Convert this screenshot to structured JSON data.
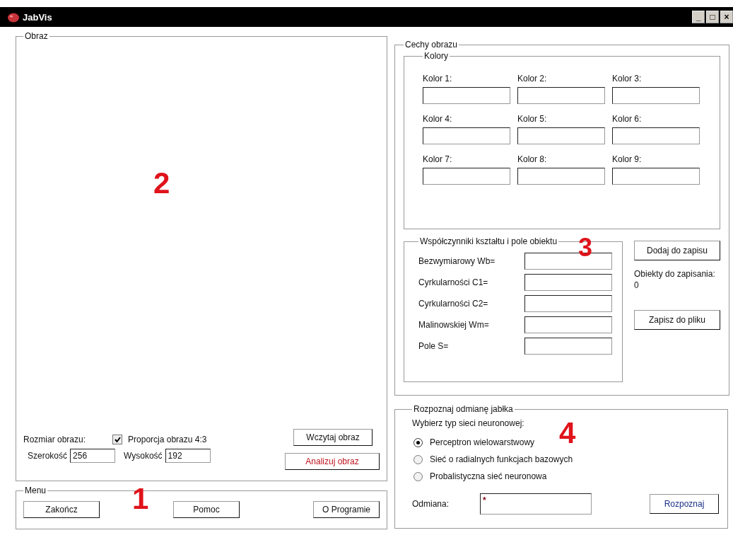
{
  "window": {
    "title": "JabVis",
    "controls": [
      "_",
      "□",
      "×"
    ]
  },
  "image_panel": {
    "title": "Obraz",
    "annotation": "2",
    "size_label": "Rozmiar obrazu:",
    "aspect": {
      "label": "Proporcja obrazu 4:3",
      "checked": true
    },
    "width_label": "Szerokość",
    "width_value": "256",
    "height_label": "Wysokość",
    "height_value": "192",
    "load_button": "Wczytaj obraz",
    "analyze_button": "Analizuj obraz"
  },
  "menu": {
    "title": "Menu",
    "annotation": "1",
    "buttons": [
      "Zakończ",
      "Pomoc",
      "O Programie"
    ]
  },
  "features": {
    "title": "Cechy obrazu",
    "colors": {
      "title": "Kolory",
      "fields": [
        {
          "label": "Kolor 1:"
        },
        {
          "label": "Kolor 2:"
        },
        {
          "label": "Kolor 3:"
        },
        {
          "label": "Kolor 4:"
        },
        {
          "label": "Kolor 5:"
        },
        {
          "label": "Kolor 6:"
        },
        {
          "label": "Kolor 7:"
        },
        {
          "label": "Kolor 8:"
        },
        {
          "label": "Kolor 9:"
        }
      ]
    },
    "shape": {
      "title": "Współczynniki kształtu i pole obiektu",
      "annotation": "3",
      "fields": [
        {
          "label": "Bezwymiarowy Wb="
        },
        {
          "label": "Cyrkularności C1="
        },
        {
          "label": "Cyrkularności C2="
        },
        {
          "label": "Malinowskiej Wm="
        },
        {
          "label": "Pole S="
        }
      ]
    },
    "add_button": "Dodaj do zapisu",
    "pending_label": "Obiekty do zapisania:",
    "pending_count": "0",
    "save_button": "Zapisz do pliku"
  },
  "recognize": {
    "title": "Rozpoznaj odmianę jabłka",
    "annotation": "4",
    "prompt": "Wybierz typ sieci neuronowej:",
    "networks": [
      {
        "label": "Perceptron wielowarstwowy",
        "selected": true
      },
      {
        "label": "Sieć o radialnych funkcjach bazowych",
        "selected": false
      },
      {
        "label": "Probalistyczna sieć neuronowa",
        "selected": false
      }
    ],
    "variety_label": "Odmiana:",
    "variety_value": "*",
    "recognize_button": "Rozpoznaj"
  }
}
